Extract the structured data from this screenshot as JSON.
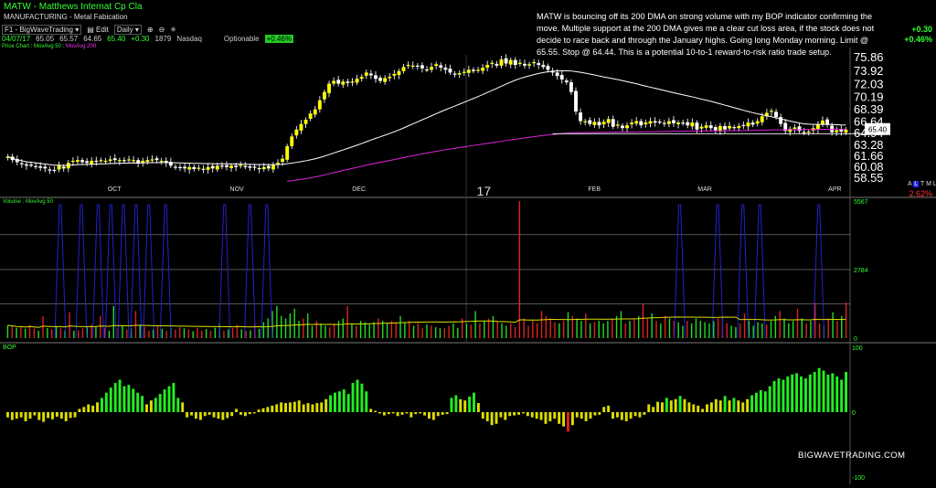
{
  "header": {
    "title": "MATW - Matthews Internat Cp Cla",
    "sector": "MANUFACTURING - Metal Fabication",
    "layout_name": "F1 - BigWaveTrading",
    "edit_label": "Edit",
    "interval": "Daily"
  },
  "quote": {
    "date": "04/07/17",
    "open": "65.05",
    "high": "65.57",
    "low": "64.65",
    "close": "65.40",
    "change": "+0.30",
    "volume": "1879",
    "exchange": "Nasdaq",
    "optionable": "Optionable",
    "pct_change": "+0.46%"
  },
  "right_change": {
    "abs": "+0.30",
    "pct": "+0.46%"
  },
  "price_legend": {
    "prefix": "Price Chart",
    "ma50": "MovAvg 50",
    "ma200": "MovAvg 200"
  },
  "annotation": "MATW is bouncing off its 200 DMA on strong volume with my BOP indicator confirming the move. Multiple support at the 200 DMA gives me a clear cut loss area, if the stock does not decide to race back and through the January highs. Going long Monday morning. Limit @ 65.55. Stop @ 64.44. This is a potential 10-to-1 reward-to-risk ratio trade setup.",
  "brand": "BIGWAVETRADING.COM",
  "side_tags": {
    "letters": [
      "A",
      "L",
      "T",
      "M",
      "L"
    ],
    "pct": "2.62%"
  },
  "volume_legend": "Volume : MovAvg 50",
  "bop_legend": "BOP",
  "colors": {
    "up": "#22dd22",
    "down": "#dd2222",
    "candle_up": "#ffff00",
    "candle_dn": "#ffffff",
    "ma50": "#ffffff",
    "ma200": "#dd22dd",
    "vol_ma": "#dddd00",
    "spike": "#2222cc",
    "bop_pos": "#22ee22",
    "bop_neg": "#dddd00",
    "text": "#cccccc"
  },
  "chart_data": [
    {
      "type": "candlestick",
      "title": "MATW - Matthews Internat Cp Cla",
      "y_ticks": [
        "75.86",
        "73.92",
        "72.03",
        "70.19",
        "68.39",
        "66.64",
        "64.94",
        "63.28",
        "61.66",
        "60.08",
        "58.55"
      ],
      "ylim": [
        58.0,
        77.2
      ],
      "x_ticks": [
        "OCT",
        "NOV",
        "DEC",
        "17",
        "FEB",
        "MAR",
        "APR"
      ],
      "last_price": "65.40",
      "series": [
        {
          "name": "MovAvg 50",
          "color": "#ffffff"
        },
        {
          "name": "MovAvg 200",
          "color": "#dd22dd"
        }
      ],
      "close": [
        61.5,
        61.0,
        60.7,
        60.4,
        60.2,
        60.3,
        60.1,
        59.9,
        59.8,
        59.6,
        59.5,
        60.2,
        59.8,
        60.6,
        60.9,
        61.0,
        60.7,
        60.6,
        60.9,
        60.8,
        61.0,
        60.9,
        61.1,
        61.0,
        61.0,
        60.9,
        61.1,
        61.0,
        60.5,
        60.9,
        61.0,
        61.1,
        61.0,
        60.9,
        60.6,
        60.2,
        60.0,
        59.9,
        59.8,
        60.0,
        59.7,
        59.9,
        59.6,
        60.0,
        59.8,
        60.2,
        60.1,
        60.0,
        60.2,
        60.0,
        60.3,
        60.1,
        59.9,
        60.0,
        59.7,
        60.0,
        59.8,
        60.3,
        60.6,
        61.2,
        63.0,
        64.4,
        65.4,
        66.2,
        66.8,
        67.7,
        68.3,
        69.6,
        70.8,
        72.0,
        72.4,
        72.0,
        72.3,
        72.1,
        72.3,
        72.7,
        73.0,
        73.6,
        73.2,
        72.7,
        72.4,
        72.8,
        73.0,
        73.4,
        73.8,
        74.4,
        74.7,
        74.6,
        74.5,
        74.2,
        74.0,
        74.4,
        74.8,
        74.3,
        74.0,
        73.6,
        73.3,
        73.5,
        73.7,
        74.0,
        73.8,
        74.0,
        74.3,
        74.7,
        75.0,
        74.6,
        75.5,
        74.9,
        75.4,
        74.7,
        75.0,
        74.6,
        74.8,
        75.1,
        74.7,
        74.4,
        74.0,
        73.6,
        73.1,
        72.6,
        72.2,
        70.8,
        68.0,
        66.6,
        66.6,
        66.2,
        66.5,
        66.0,
        66.5,
        66.9,
        65.8,
        66.1,
        65.6,
        66.0,
        66.4,
        66.6,
        66.0,
        66.4,
        66.6,
        66.4,
        66.5,
        66.2,
        66.6,
        66.3,
        66.4,
        66.3,
        66.0,
        66.4,
        65.4,
        65.8,
        66.0,
        65.6,
        65.3,
        65.9,
        65.4,
        65.9,
        65.6,
        65.9,
        66.0,
        66.4,
        66.1,
        66.6,
        67.3,
        67.8,
        68.1,
        67.2,
        66.2,
        65.2,
        65.5,
        65.7,
        65.2,
        65.0,
        65.1,
        65.6,
        66.1,
        66.7,
        66.1,
        65.0,
        65.3,
        65.1,
        65.4
      ]
    },
    {
      "type": "bar",
      "title": "Volume : MovAvg 50",
      "y_ticks": [
        "5567",
        "2784",
        "0"
      ],
      "ylim": [
        0,
        5567
      ],
      "values": [
        520,
        480,
        420,
        460,
        380,
        540,
        390,
        300,
        880,
        410,
        360,
        500,
        400,
        310,
        1050,
        300,
        320,
        400,
        430,
        550,
        480,
        900,
        420,
        300,
        1300,
        400,
        520,
        350,
        400,
        1100,
        520,
        460,
        300,
        350,
        500,
        380,
        290,
        410,
        350,
        440,
        400,
        350,
        280,
        420,
        300,
        370,
        300,
        420,
        600,
        300,
        350,
        400,
        550,
        360,
        300,
        320,
        600,
        380,
        650,
        800,
        1100,
        1300,
        900,
        800,
        1000,
        1200,
        700,
        800,
        1000,
        500,
        700,
        600,
        500,
        450,
        600,
        700,
        800,
        1300,
        600,
        500,
        700,
        650,
        550,
        650,
        800,
        700,
        600,
        700,
        650,
        900,
        650,
        700,
        500,
        600,
        400,
        550,
        500,
        450,
        400,
        400,
        500,
        600,
        420,
        800,
        600,
        550,
        1100,
        600,
        700,
        800,
        900,
        700,
        600,
        500,
        600,
        450,
        5567,
        800,
        500,
        700,
        600,
        1100,
        900,
        800,
        650,
        600,
        700,
        1050,
        900,
        800,
        700,
        1000,
        600,
        650,
        700,
        600,
        700,
        800,
        900,
        1100,
        600,
        700,
        800,
        900,
        1400,
        800,
        1000,
        700,
        600,
        900,
        800,
        700,
        650,
        500,
        700,
        600,
        800,
        700,
        650,
        600,
        700,
        800,
        900,
        600,
        500,
        450,
        600,
        1000,
        700,
        500,
        650,
        600,
        550,
        700,
        900,
        1100,
        800,
        600,
        700,
        1200,
        800,
        600,
        700,
        1450,
        600,
        500,
        800,
        1050,
        700,
        900,
        1450
      ],
      "colors_up": [
        1,
        0,
        1,
        0,
        1,
        0,
        0,
        1,
        0,
        1,
        0,
        1,
        0,
        1,
        0,
        1,
        0,
        0,
        1,
        0,
        1,
        0,
        0,
        1,
        1,
        0,
        1,
        0,
        1,
        0,
        1,
        0,
        0,
        1,
        0,
        1,
        0,
        1,
        0,
        0,
        1,
        0,
        1,
        0,
        0,
        1,
        0,
        1,
        1,
        0,
        1,
        0,
        0,
        1,
        0,
        1,
        0,
        1,
        1,
        1,
        1,
        1,
        1,
        1,
        1,
        1,
        1,
        0,
        1,
        1,
        0,
        1,
        1,
        0,
        0,
        1,
        1,
        0,
        1,
        0,
        1,
        1,
        1,
        1,
        0,
        1,
        1,
        0,
        0,
        1,
        1,
        0,
        1,
        0,
        0,
        1,
        0,
        1,
        1,
        0,
        0,
        1,
        1,
        0,
        1,
        0,
        1,
        0,
        1,
        0,
        1,
        0,
        1,
        1,
        0,
        0,
        0,
        0,
        0,
        0,
        0,
        0,
        0,
        0,
        0,
        1,
        0,
        1,
        0,
        1,
        1,
        0,
        1,
        0,
        1,
        1,
        1,
        0,
        1,
        1,
        0,
        1,
        0,
        1,
        0,
        0,
        1,
        0,
        1,
        0,
        1,
        0,
        1,
        1,
        0,
        1,
        1,
        1,
        1,
        1,
        1,
        0,
        0,
        0,
        1,
        1,
        0,
        0,
        1,
        1,
        1,
        1,
        0,
        1,
        1,
        0,
        1,
        1
      ],
      "spikes": [
        1400,
        1400,
        1400,
        1400,
        1400,
        1400,
        1400,
        1400,
        1400,
        1400,
        1400,
        1400,
        1400,
        1400,
        1400,
        1400
      ]
    },
    {
      "type": "bar",
      "title": "BOP",
      "y_ticks": [
        "100",
        "0",
        "-100"
      ],
      "ylim": [
        -100,
        100
      ],
      "values": [
        -8,
        -12,
        -10,
        -8,
        -14,
        -10,
        -5,
        -12,
        -15,
        -9,
        -11,
        -7,
        -10,
        -14,
        -9,
        -8,
        5,
        8,
        12,
        10,
        15,
        22,
        30,
        38,
        45,
        50,
        40,
        42,
        36,
        30,
        25,
        12,
        18,
        22,
        28,
        35,
        40,
        45,
        22,
        15,
        -8,
        -5,
        -10,
        -12,
        -6,
        -4,
        -8,
        -10,
        -12,
        -9,
        -6,
        5,
        -4,
        -6,
        -3,
        -2,
        4,
        6,
        8,
        10,
        12,
        15,
        14,
        15,
        16,
        18,
        12,
        14,
        12,
        14,
        15,
        20,
        26,
        30,
        32,
        35,
        28,
        45,
        50,
        44,
        32,
        5,
        2,
        -2,
        -5,
        -3,
        -2,
        -6,
        -4,
        -2,
        -8,
        -3,
        -2,
        -5,
        -10,
        -12,
        -6,
        -4,
        -3,
        22,
        26,
        20,
        18,
        24,
        30,
        14,
        -10,
        -14,
        -20,
        -18,
        -8,
        -12,
        -6,
        -5,
        -4,
        -2,
        -6,
        -8,
        -10,
        -12,
        -18,
        -14,
        -10,
        -18,
        -22,
        -30,
        -20,
        -8,
        -10,
        -14,
        -10,
        -5,
        -4,
        8,
        10,
        -10,
        -8,
        -12,
        -14,
        -10,
        -6,
        -8,
        -4,
        12,
        8,
        16,
        15,
        22,
        18,
        20,
        25,
        20,
        15,
        12,
        10,
        5,
        12,
        15,
        20,
        18,
        25,
        18,
        22,
        18,
        15,
        20,
        26,
        30,
        34,
        32,
        40,
        48,
        52,
        50,
        55,
        58,
        60,
        55,
        52,
        58,
        62,
        68,
        64,
        58,
        60,
        55,
        50,
        62
      ]
    }
  ]
}
